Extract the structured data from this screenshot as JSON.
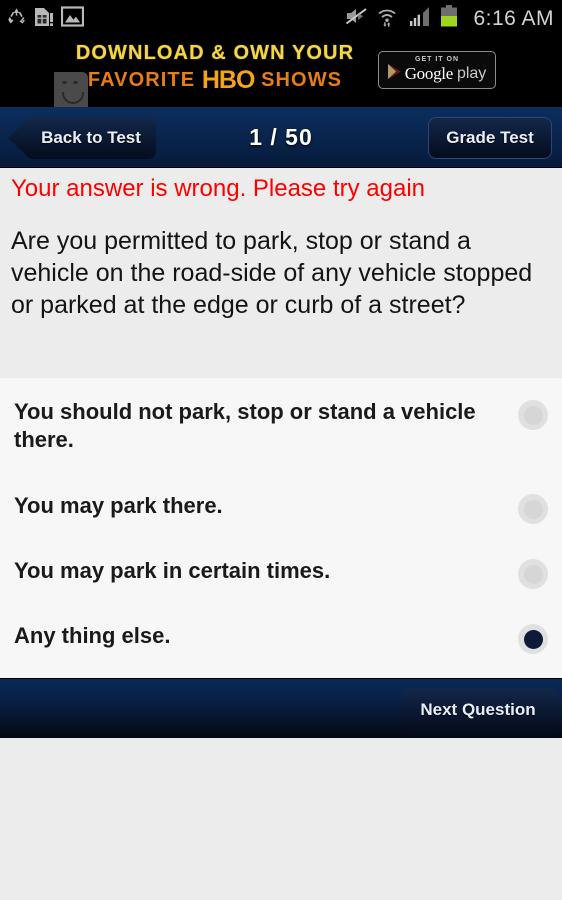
{
  "statusbar": {
    "icons_left": [
      "recycle-icon",
      "sim-card-alert-icon",
      "gallery-image-icon"
    ],
    "icons_right": [
      "mute-icon",
      "wifi-data-icon",
      "signal-bars-icon",
      "battery-icon"
    ],
    "time": "6:16 AM"
  },
  "ad": {
    "line1": "DOWNLOAD & OWN YOUR",
    "line2_pre": "FAVORITE ",
    "line2_brand": "HBO",
    "line2_post": " SHOWS",
    "badge_top": "GET IT ON",
    "badge_google": "Google",
    "badge_play": "play",
    "broken_image_icon": "broken-image-sad-face-icon"
  },
  "topnav": {
    "back_label": "Back to Test",
    "counter": "1 / 50",
    "grade_label": "Grade Test"
  },
  "question": {
    "error": "Your answer is wrong. Please try again",
    "text": "Are you permitted to park, stop or stand a vehicle on the road-side of any vehicle stopped or parked at the edge or curb of a street?"
  },
  "options": [
    {
      "label": "You should not park, stop or stand a vehicle there.",
      "selected": false
    },
    {
      "label": "You may park there.",
      "selected": false
    },
    {
      "label": "You may park in certain times.",
      "selected": false
    },
    {
      "label": "Any thing else.",
      "selected": true
    }
  ],
  "bottombar": {
    "next_label": "Next Question"
  },
  "colors": {
    "error_red": "#ff0000",
    "nav_blue": "#0a2752",
    "selected_radio": "#0d1b38",
    "ad_yellow": "#f3d54a",
    "ad_orange": "#e87c17",
    "page_bg": "#ececec",
    "options_bg": "#f7f7f7"
  }
}
